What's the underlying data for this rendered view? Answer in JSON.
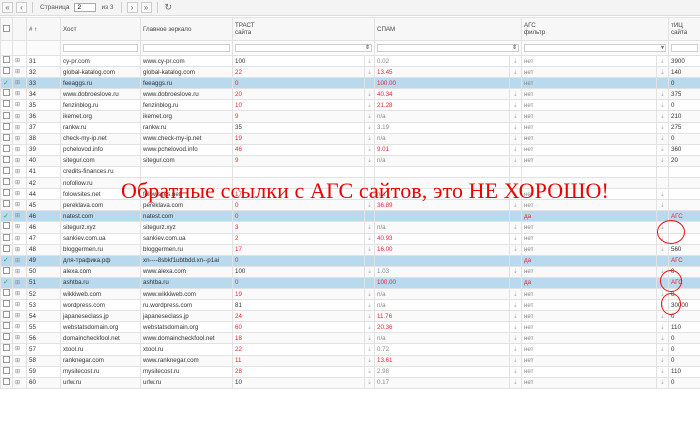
{
  "pager": {
    "first_icon": "first-page-icon",
    "prev_icon": "prev-page-icon",
    "page_label": "Страница",
    "page_value": "2",
    "of_label": "из 3",
    "next_icon": "next-page-icon",
    "last_icon": "last-page-icon",
    "refresh_icon": "refresh-icon"
  },
  "columns": {
    "num": "# ↑",
    "host": "Хост",
    "mirror": "Главное зеркало",
    "trust": "ТРАСТ сайта",
    "spam": "СПАМ",
    "ags": "АГС фильтр",
    "tic": "тИЦ сайта"
  },
  "overlay_text": "Обратные ссылки с АГС сайтов, это НЕ ХОРОШО!",
  "rows": [
    {
      "n": "31",
      "host": "cy-pr.com",
      "mirror": "www.cy-pr.com",
      "trust": "100",
      "spam": "0.02",
      "ags": "нет",
      "tic": "3900",
      "sel": false,
      "tr": false,
      "sr": false
    },
    {
      "n": "32",
      "host": "global-katalog.com",
      "mirror": "global-katalog.com",
      "trust": "22",
      "spam": "13.45",
      "ags": "нет",
      "tic": "140",
      "sel": false,
      "tr": true,
      "sr": true
    },
    {
      "n": "33",
      "host": "feeaggs.ru",
      "mirror": "feeaggs.ru",
      "trust": "0",
      "spam": "100.00",
      "ags": "нет",
      "tic": "0",
      "sel": true,
      "tr": true,
      "sr": true
    },
    {
      "n": "34",
      "host": "www.dobroeslove.ru",
      "mirror": "www.dobroeslove.ru",
      "trust": "20",
      "spam": "40.34",
      "ags": "нет",
      "tic": "375",
      "sel": false,
      "tr": true,
      "sr": true
    },
    {
      "n": "35",
      "host": "fenzinblog.ru",
      "mirror": "fenzinblog.ru",
      "trust": "10",
      "spam": "21.28",
      "ags": "нет",
      "tic": "0",
      "sel": false,
      "tr": true,
      "sr": true
    },
    {
      "n": "36",
      "host": "ikemet.org",
      "mirror": "ikemet.org",
      "trust": "9",
      "spam": "n/a",
      "ags": "нет",
      "tic": "210",
      "sel": false,
      "tr": true,
      "sr": false
    },
    {
      "n": "37",
      "host": "rankw.ru",
      "mirror": "rankw.ru",
      "trust": "35",
      "spam": "3.19",
      "ags": "нет",
      "tic": "275",
      "sel": false,
      "tr": false,
      "sr": false
    },
    {
      "n": "38",
      "host": "check-my-ip.net",
      "mirror": "www.check-my-ip.net",
      "trust": "19",
      "spam": "n/a",
      "ags": "нет",
      "tic": "0",
      "sel": false,
      "tr": true,
      "sr": false
    },
    {
      "n": "39",
      "host": "pchelovod.info",
      "mirror": "www.pchelovod.info",
      "trust": "46",
      "spam": "9.01",
      "ags": "нет",
      "tic": "360",
      "sel": false,
      "tr": true,
      "sr": true
    },
    {
      "n": "40",
      "host": "sitegur.com",
      "mirror": "sitegur.com",
      "trust": "9",
      "spam": "n/a",
      "ags": "нет",
      "tic": "20",
      "sel": false,
      "tr": true,
      "sr": false
    },
    {
      "n": "41",
      "host": "credits-finances.ru",
      "mirror": "",
      "trust": "",
      "spam": "",
      "ags": "",
      "tic": "",
      "sel": false,
      "tr": false,
      "sr": false
    },
    {
      "n": "42",
      "host": "nofollow.ru",
      "mirror": "",
      "trust": "",
      "spam": "",
      "ags": "",
      "tic": "",
      "sel": false,
      "tr": false,
      "sr": false
    },
    {
      "n": "44",
      "host": "folowsites.net",
      "mirror": "folowsites.net",
      "trust": "17",
      "spam": "n/a",
      "ags": "нет",
      "tic": "",
      "sel": false,
      "tr": true,
      "sr": false
    },
    {
      "n": "45",
      "host": "pereklava.com",
      "mirror": "pereklava.com",
      "trust": "0",
      "spam": "36.89",
      "ags": "нет",
      "tic": "",
      "sel": false,
      "tr": true,
      "sr": true
    },
    {
      "n": "46",
      "host": "natest.com",
      "mirror": "natest.com",
      "trust": "0",
      "spam": "",
      "ags": "да",
      "tic": "АГС",
      "sel": true,
      "tr": true,
      "sr": false
    },
    {
      "n": "46",
      "host": "sitegurz.xyz",
      "mirror": "sitegurz.xyz",
      "trust": "3",
      "spam": "n/a",
      "ags": "нет",
      "tic": "",
      "sel": false,
      "tr": true,
      "sr": false
    },
    {
      "n": "47",
      "host": "sankiev.com.ua",
      "mirror": "sankiev.com.ua",
      "trust": "2",
      "spam": "40.93",
      "ags": "нет",
      "tic": "",
      "sel": false,
      "tr": true,
      "sr": true
    },
    {
      "n": "48",
      "host": "bloggermen.ru",
      "mirror": "bloggermen.ru",
      "trust": "17",
      "spam": "16.00",
      "ags": "нет",
      "tic": "560",
      "sel": false,
      "tr": true,
      "sr": true
    },
    {
      "n": "49",
      "host": "для-трафика.рф",
      "mirror": "xn----8sbkf1ubtbdd.xn--p1ai",
      "trust": "0",
      "spam": "",
      "ags": "да",
      "tic": "АГС",
      "sel": true,
      "tr": true,
      "sr": false
    },
    {
      "n": "50",
      "host": "alexa.com",
      "mirror": "www.alexa.com",
      "trust": "100",
      "spam": "1.03",
      "ags": "нет",
      "tic": "0",
      "sel": false,
      "tr": false,
      "sr": false
    },
    {
      "n": "51",
      "host": "ashtba.ru",
      "mirror": "ashtba.ru",
      "trust": "0",
      "spam": "100.00",
      "ags": "да",
      "tic": "АГС",
      "sel": true,
      "tr": true,
      "sr": true
    },
    {
      "n": "52",
      "host": "wikkiweb.com",
      "mirror": "www.wikkiweb.com",
      "trust": "19",
      "spam": "n/a",
      "ags": "нет",
      "tic": "0",
      "sel": false,
      "tr": true,
      "sr": false
    },
    {
      "n": "53",
      "host": "wordpress.com",
      "mirror": "ru.wordpress.com",
      "trust": "81",
      "spam": "n/a",
      "ags": "нет",
      "tic": "30000",
      "sel": false,
      "tr": false,
      "sr": false
    },
    {
      "n": "54",
      "host": "japaneseclass.jp",
      "mirror": "japaneseclass.jp",
      "trust": "24",
      "spam": "11.76",
      "ags": "нет",
      "tic": "0",
      "sel": false,
      "tr": true,
      "sr": true
    },
    {
      "n": "55",
      "host": "webstatsdomain.org",
      "mirror": "webstatsdomain.org",
      "trust": "60",
      "spam": "20.36",
      "ags": "нет",
      "tic": "110",
      "sel": false,
      "tr": true,
      "sr": true
    },
    {
      "n": "56",
      "host": "domaincheckfool.net",
      "mirror": "www.domaincheckfool.net",
      "trust": "18",
      "spam": "n/a",
      "ags": "нет",
      "tic": "0",
      "sel": false,
      "tr": true,
      "sr": false
    },
    {
      "n": "57",
      "host": "xtool.ru",
      "mirror": "xtool.ru",
      "trust": "22",
      "spam": "0.72",
      "ags": "нет",
      "tic": "0",
      "sel": false,
      "tr": true,
      "sr": false
    },
    {
      "n": "58",
      "host": "ranknegar.com",
      "mirror": "www.ranknegar.com",
      "trust": "11",
      "spam": "13.61",
      "ags": "нет",
      "tic": "0",
      "sel": false,
      "tr": true,
      "sr": true
    },
    {
      "n": "59",
      "host": "mysitecost.ru",
      "mirror": "mysitecost.ru",
      "trust": "28",
      "spam": "2.98",
      "ags": "нет",
      "tic": "110",
      "sel": false,
      "tr": true,
      "sr": false
    },
    {
      "n": "60",
      "host": "urlw.ru",
      "mirror": "urlw.ru",
      "trust": "10",
      "spam": "0.17",
      "ags": "нет",
      "tic": "0",
      "sel": false,
      "tr": false,
      "sr": false
    }
  ]
}
